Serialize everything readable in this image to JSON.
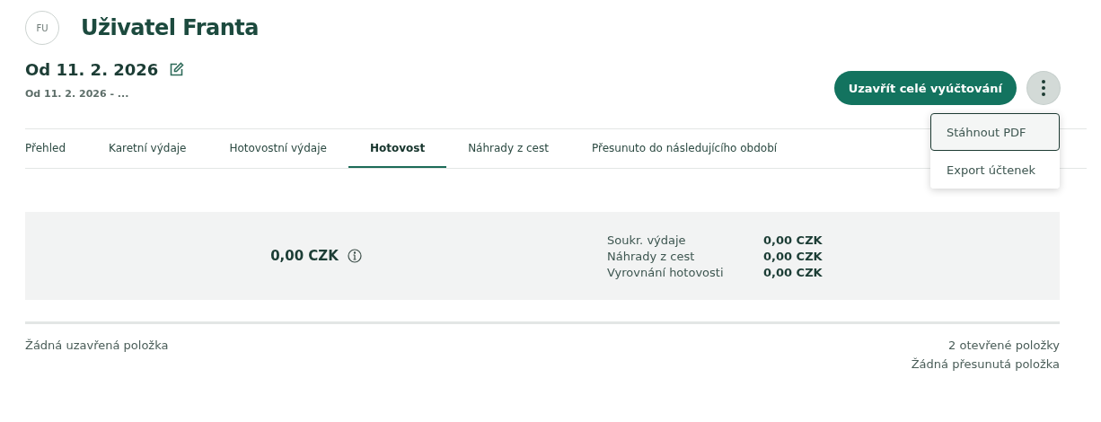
{
  "user": {
    "initials": "FU",
    "name": "Uživatel Franta"
  },
  "period": {
    "title": "Od 11. 2. 2026",
    "subtitle": "Od 11. 2. 2026 - ..."
  },
  "close_button": "Uzavřít celé vyúčtování",
  "menu": {
    "expanded": true,
    "items": [
      {
        "label": "Stáhnout PDF",
        "selected": true
      },
      {
        "label": "Export účtenek",
        "selected": false
      }
    ]
  },
  "tabs": [
    {
      "label": "Přehled",
      "selected": false
    },
    {
      "label": "Karetní výdaje",
      "selected": false
    },
    {
      "label": "Hotovostní výdaje",
      "selected": false
    },
    {
      "label": "Hotovost",
      "selected": true
    },
    {
      "label": "Náhrady z cest",
      "selected": false
    },
    {
      "label": "Přesunuto do následujícího období",
      "selected": false
    }
  ],
  "summary": {
    "total": "0,00 CZK",
    "rows": [
      {
        "label": "Soukr. výdaje",
        "value": "0,00 CZK"
      },
      {
        "label": "Náhrady z cest",
        "value": "0,00 CZK"
      },
      {
        "label": "Vyrovnání hotovosti",
        "value": "0,00 CZK"
      }
    ]
  },
  "footer": {
    "closed": "Žádná uzavřená položka",
    "open": "2 otevřené položky",
    "moved": "Žádná přesunutá položka"
  }
}
